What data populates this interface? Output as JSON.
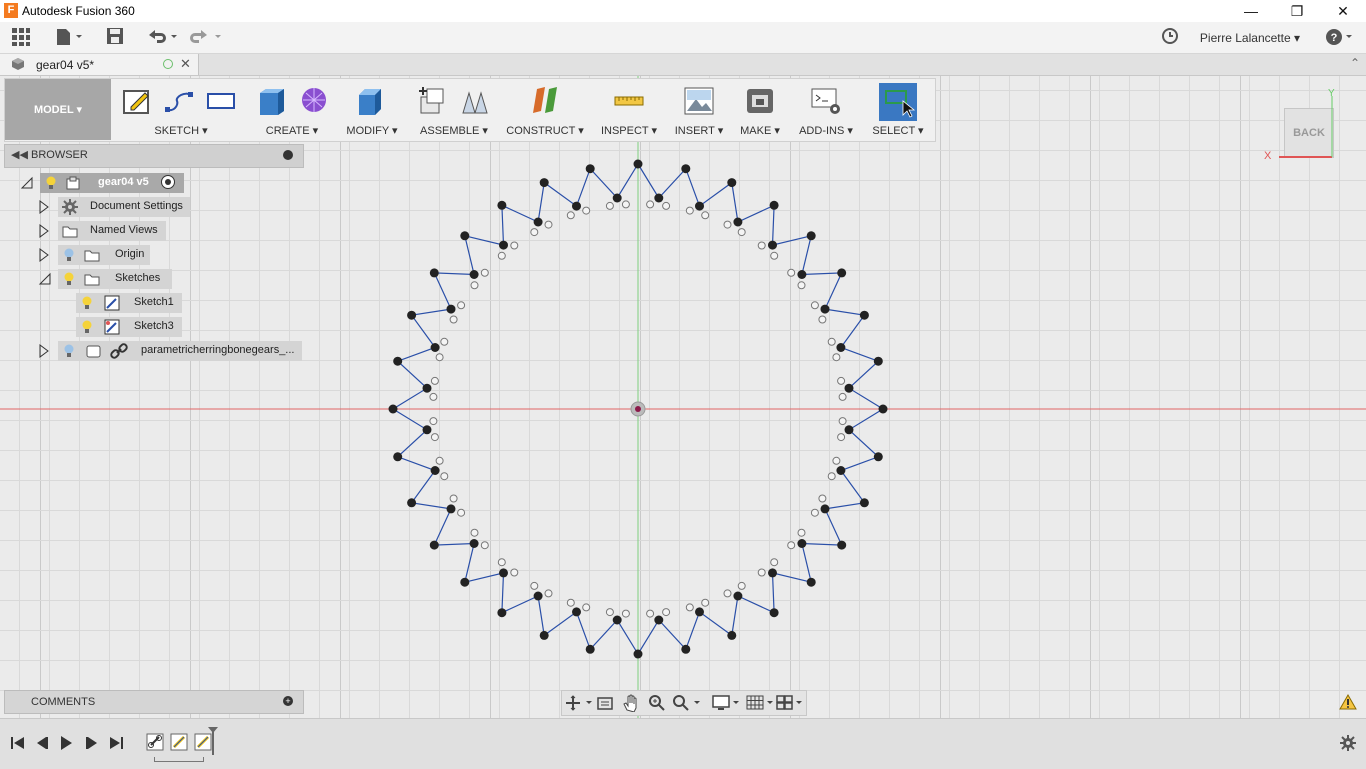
{
  "window": {
    "title": "Autodesk Fusion 360",
    "app_icon_letter": "F"
  },
  "user": {
    "name": "Pierre Lalancette"
  },
  "document": {
    "tab_title": "gear04 v5*"
  },
  "workspace": {
    "label": "MODEL"
  },
  "toolbar": {
    "groups": [
      {
        "label": "SKETCH",
        "icons": [
          "create-sketch-icon",
          "arc-icon",
          "rectangle-icon"
        ]
      },
      {
        "label": "CREATE",
        "icons": [
          "extrude-icon",
          "form-icon"
        ]
      },
      {
        "label": "MODIFY",
        "icons": [
          "press-pull-icon"
        ]
      },
      {
        "label": "ASSEMBLE",
        "icons": [
          "new-component-icon",
          "joint-icon"
        ]
      },
      {
        "label": "CONSTRUCT",
        "icons": [
          "offset-plane-icon"
        ]
      },
      {
        "label": "INSPECT",
        "icons": [
          "measure-icon"
        ]
      },
      {
        "label": "INSERT",
        "icons": [
          "insert-image-icon"
        ]
      },
      {
        "label": "MAKE",
        "icons": [
          "3d-print-icon"
        ]
      },
      {
        "label": "ADD-INS",
        "icons": [
          "scripts-icon"
        ]
      },
      {
        "label": "SELECT",
        "icons": [
          "select-icon"
        ]
      }
    ]
  },
  "browser": {
    "title": "BROWSER",
    "items": [
      {
        "label": "gear04 v5"
      },
      {
        "label": "Document Settings"
      },
      {
        "label": "Named Views"
      },
      {
        "label": "Origin"
      },
      {
        "label": "Sketches"
      },
      {
        "label": "Sketch1"
      },
      {
        "label": "Sketch3"
      },
      {
        "label": "parametricherringbonegears_..."
      }
    ]
  },
  "comments": {
    "title": "COMMENTS"
  },
  "viewcube": {
    "face_label": "BACK",
    "axis_x": "X",
    "axis_y": "Y"
  },
  "gear": {
    "teeth": 32,
    "color_line": "#2a4fa8",
    "color_point": "#222222"
  },
  "colors": {
    "x_axis": "#e05555",
    "y_axis": "#66cc66",
    "select_active": "#3a78c2",
    "workspace_bg": "#a7a7a7"
  }
}
